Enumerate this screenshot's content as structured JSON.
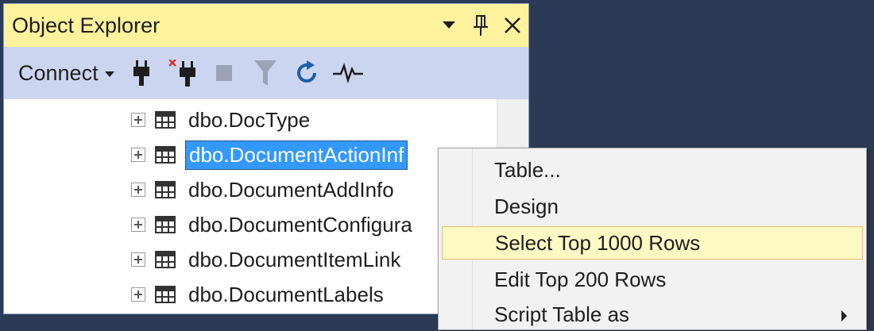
{
  "panel": {
    "title": "Object Explorer",
    "title_controls": [
      "dropdown-icon",
      "pin-icon",
      "close-icon"
    ]
  },
  "toolbar": {
    "connect_label": "Connect",
    "tools": [
      "connect-plug-icon",
      "disconnect-icon",
      "stop-icon",
      "filter-icon",
      "refresh-icon",
      "activity-monitor-icon"
    ]
  },
  "tree": {
    "rows": [
      {
        "label": "dbo.DocType"
      },
      {
        "label": "dbo.DocumentActionInf"
      },
      {
        "label": "dbo.DocumentAddInfo"
      },
      {
        "label": "dbo.DocumentConfigura"
      },
      {
        "label": "dbo.DocumentItemLink"
      },
      {
        "label": "dbo.DocumentLabels"
      }
    ],
    "selected_index": 1
  },
  "context_menu": {
    "items": [
      {
        "label": "Table..."
      },
      {
        "label": "Design"
      },
      {
        "label": "Select Top 1000 Rows"
      },
      {
        "label": "Edit Top 200 Rows"
      },
      {
        "label": "Script Table as"
      }
    ],
    "hover_index": 2
  },
  "colors": {
    "titlebar": "#fff29d",
    "toolbar": "#ccd5f0",
    "selection": "#3399ff",
    "menu_hover": "#fff9c4",
    "background": "#2b3a55"
  }
}
